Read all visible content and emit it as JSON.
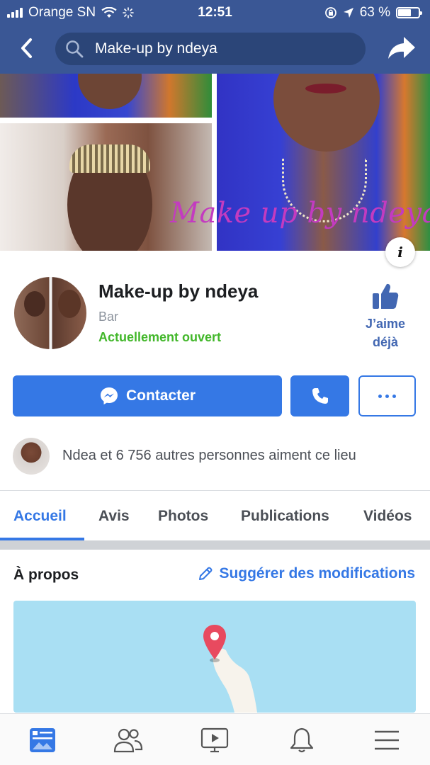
{
  "status_bar": {
    "carrier": "Orange SN",
    "time": "12:51",
    "battery_text": "63 %",
    "battery_level": 0.63
  },
  "header": {
    "search_text": "Make-up by ndeya",
    "back_icon": "chevron-left-icon",
    "share_icon": "share-arrow-icon",
    "background_color": "#3a5795"
  },
  "cover": {
    "overlay_text": "Make up by ndeya",
    "info_label": "i"
  },
  "profile": {
    "name": "Make-up by ndeya",
    "category": "Bar",
    "status": "Actuellement ouvert",
    "like_label_line1": "J’aime",
    "like_label_line2": "déjà"
  },
  "actions": {
    "contact_label": "Contacter",
    "call_icon": "phone-icon",
    "more_icon": "more-dots-icon",
    "accent_color": "#3578e5"
  },
  "likes": {
    "text": "Ndea et 6 756 autres personnes aiment ce lieu"
  },
  "tabs": [
    {
      "label": "Accueil",
      "active": true
    },
    {
      "label": "Avis",
      "active": false
    },
    {
      "label": "Photos",
      "active": false
    },
    {
      "label": "Publications",
      "active": false
    },
    {
      "label": "Vidéos",
      "active": false
    }
  ],
  "about": {
    "title": "À propos",
    "suggest_label": "Suggérer des modifications"
  },
  "bottom_nav": [
    {
      "icon": "news-feed-icon",
      "active": true
    },
    {
      "icon": "friends-icon",
      "active": false
    },
    {
      "icon": "watch-video-icon",
      "active": false
    },
    {
      "icon": "notifications-bell-icon",
      "active": false
    },
    {
      "icon": "menu-icon",
      "active": false
    }
  ]
}
